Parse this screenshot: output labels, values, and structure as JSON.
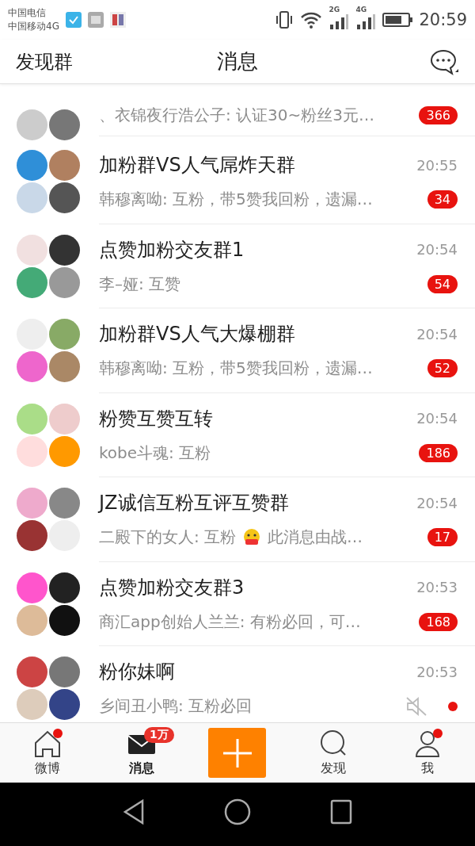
{
  "status_bar": {
    "carriers": [
      "中国电信",
      "中国移动4G"
    ],
    "network_labels": [
      "2G",
      "4G"
    ],
    "time": "20:59"
  },
  "header": {
    "left": "发现群",
    "title": "消息"
  },
  "conversations": [
    {
      "partial": true,
      "preview": "、衣锦夜行浩公子: 认证30~粉丝3元…",
      "badge": "366",
      "muted": false
    },
    {
      "partial": false,
      "title": "加粉群VS人气屌炸天群",
      "time": "20:55",
      "preview": "韩穆离呦: 互粉，带5赞我回粉，遗漏…",
      "badge": "34",
      "muted": false
    },
    {
      "partial": false,
      "title": "点赞加粉交友群1",
      "time": "20:54",
      "preview": "李–娅: 互赞",
      "badge": "54",
      "muted": false
    },
    {
      "partial": false,
      "title": "加粉群VS人气大爆棚群",
      "time": "20:54",
      "preview": "韩穆离呦: 互粉，带5赞我回粉，遗漏…",
      "badge": "52",
      "muted": false
    },
    {
      "partial": false,
      "title": "粉赞互赞互转",
      "time": "20:54",
      "preview": "kobe斗魂: 互粉",
      "badge": "186",
      "muted": false
    },
    {
      "partial": false,
      "title": "JZ诚信互粉互评互赞群",
      "time": "20:54",
      "preview": "二殿下的女人: 互粉",
      "preview_after": "此消息由战…",
      "badge": "17",
      "muted": false
    },
    {
      "partial": false,
      "title": "点赞加粉交友群3",
      "time": "20:53",
      "preview": "商汇app创始人兰兰: 有粉必回，可…",
      "badge": "168",
      "muted": false
    },
    {
      "partial": false,
      "title": "粉你妹啊",
      "time": "20:53",
      "preview": "乡间丑小鸭: 互粉必回",
      "muted": true
    }
  ],
  "tab_bar": [
    {
      "kind": "home",
      "label": "微博",
      "selected": false,
      "dot": true
    },
    {
      "kind": "mail",
      "label": "消息",
      "selected": true,
      "dot": false,
      "badge": "1万"
    },
    {
      "kind": "plus"
    },
    {
      "kind": "search",
      "label": "发现",
      "selected": false,
      "dot": false
    },
    {
      "kind": "person",
      "label": "我",
      "selected": false,
      "dot": true
    }
  ]
}
